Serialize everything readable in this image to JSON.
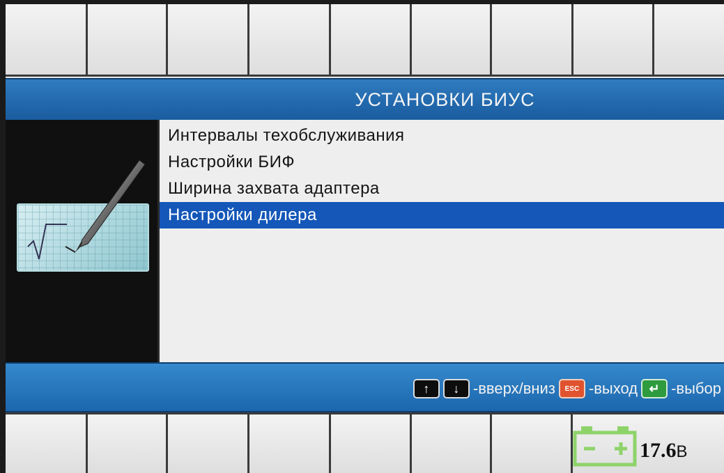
{
  "header": {
    "title": "УСТАНОВКИ БИУС"
  },
  "menu": {
    "items": [
      {
        "label": "Интервалы техобслуживания",
        "selected": false
      },
      {
        "label": "Настройки БИФ",
        "selected": false
      },
      {
        "label": "Ширина захвата адаптера",
        "selected": false
      },
      {
        "label": "Настройки дилера",
        "selected": true
      }
    ]
  },
  "hints": {
    "up_down": "-вверх/вниз",
    "esc_key": "ESC",
    "exit": "-выход",
    "select": "-выбор"
  },
  "status": {
    "voltage_value": "17.6",
    "voltage_unit": "В"
  },
  "icons": {
    "panel": "pen-on-paper-icon",
    "up": "arrow-up-icon",
    "down": "arrow-down-icon",
    "esc": "esc-key-icon",
    "enter": "enter-key-icon",
    "battery": "battery-icon"
  },
  "colors": {
    "header_bar": "#1f66ad",
    "selection": "#1457b8",
    "esc_key": "#e0532f",
    "enter_key": "#2e9b3f",
    "battery": "#8ed36a"
  }
}
